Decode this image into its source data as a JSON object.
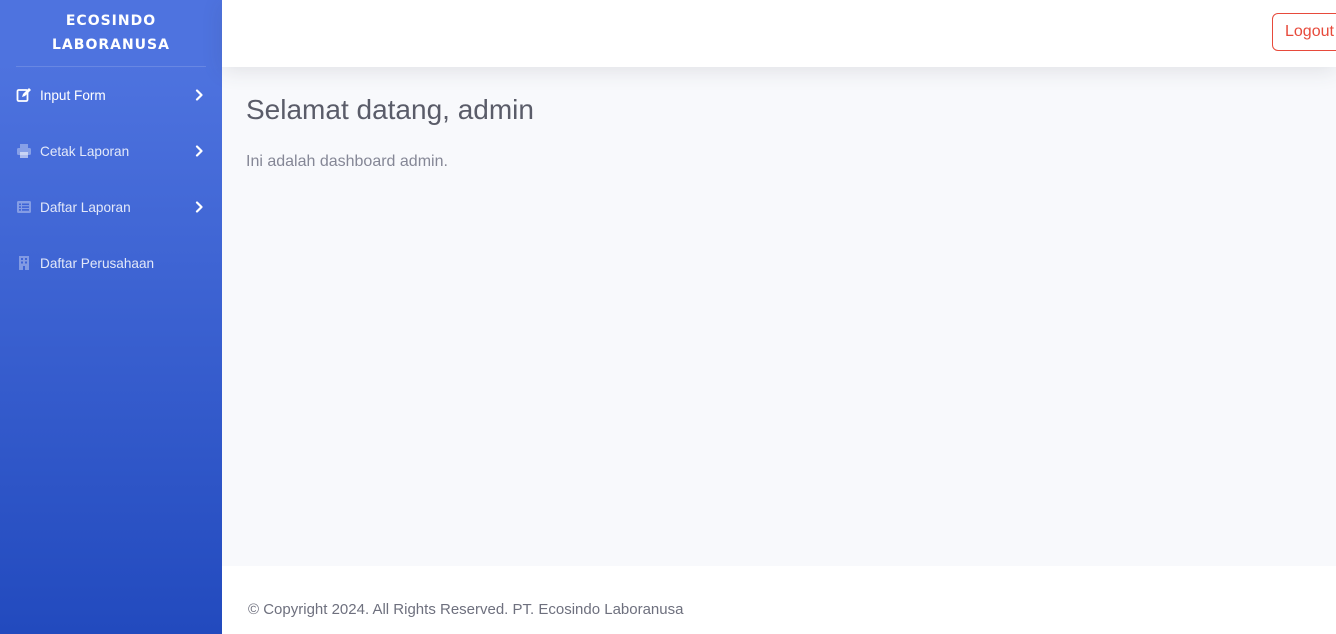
{
  "brand": {
    "name": "ECOSINDO LABORANUSA"
  },
  "sidebar": {
    "items": [
      {
        "label": "Input Form",
        "icon": "edit-icon",
        "has_submenu": true
      },
      {
        "label": "Cetak Laporan",
        "icon": "print-icon",
        "has_submenu": true
      },
      {
        "label": "Daftar Laporan",
        "icon": "list-icon",
        "has_submenu": true
      },
      {
        "label": "Daftar Perusahaan",
        "icon": "building-icon",
        "has_submenu": false
      }
    ]
  },
  "topbar": {
    "logout_label": "Logout"
  },
  "main": {
    "title": "Selamat datang, admin",
    "description": "Ini adalah dashboard admin."
  },
  "footer": {
    "text": "© Copyright 2024. All Rights Reserved. PT. Ecosindo Laboranusa"
  },
  "colors": {
    "sidebar_top": "#4e73df",
    "sidebar_bottom": "#224abe",
    "logout": "#e74a3b",
    "background": "#f8f9fc"
  }
}
